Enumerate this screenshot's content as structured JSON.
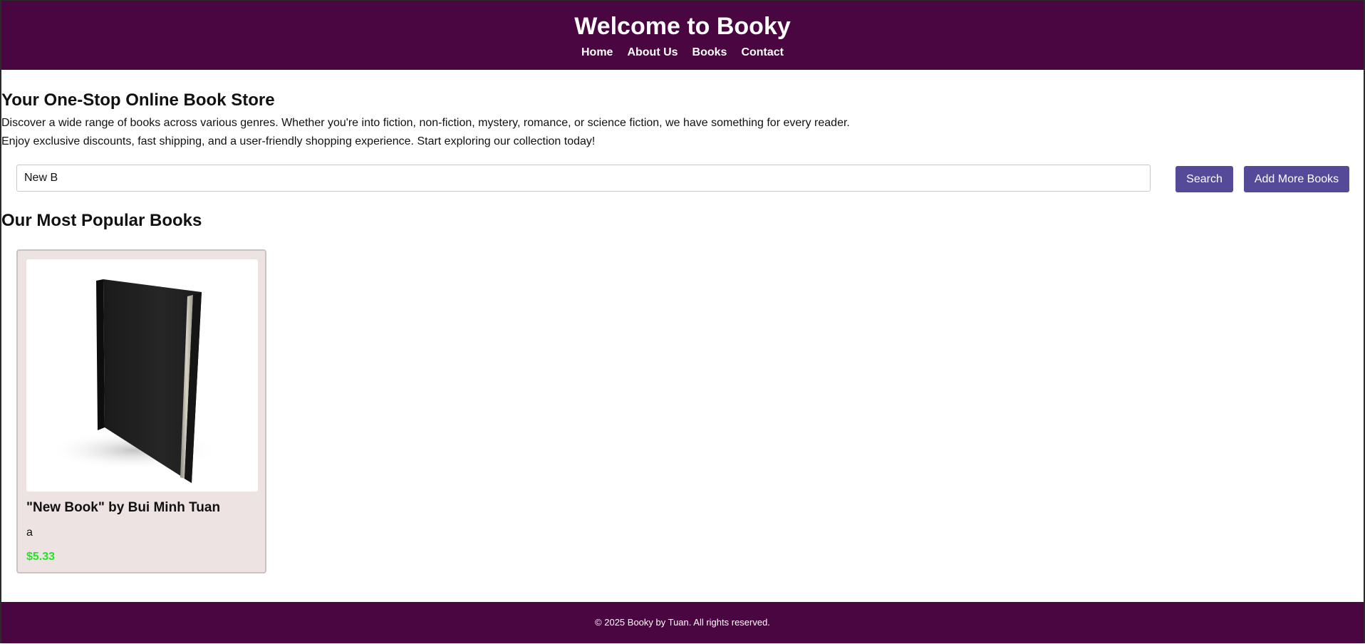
{
  "header": {
    "title": "Welcome to Booky",
    "nav": [
      "Home",
      "About Us",
      "Books",
      "Contact"
    ]
  },
  "hero": {
    "title": "Your One-Stop Online Book Store",
    "line1": "Discover a wide range of books across various genres. Whether you're into fiction, non-fiction, mystery, romance, or science fiction, we have something for every reader.",
    "line2": "Enjoy exclusive discounts, fast shipping, and a user-friendly shopping experience. Start exploring our collection today!"
  },
  "search": {
    "value": "New B",
    "button_label": "Search",
    "add_button_label": "Add More Books"
  },
  "popular": {
    "title": "Our Most Popular Books",
    "books": [
      {
        "title": "\"New Book\" by Bui Minh Tuan",
        "description": "a",
        "price": "$5.33",
        "image_icon": "book-cover-image"
      }
    ]
  },
  "footer": {
    "text": "© 2025 Booky by Tuan. All rights reserved."
  },
  "colors": {
    "header_bg": "#4a0640",
    "button_bg": "#544a99",
    "card_bg": "#ede3e3",
    "price": "#1ee81e"
  }
}
